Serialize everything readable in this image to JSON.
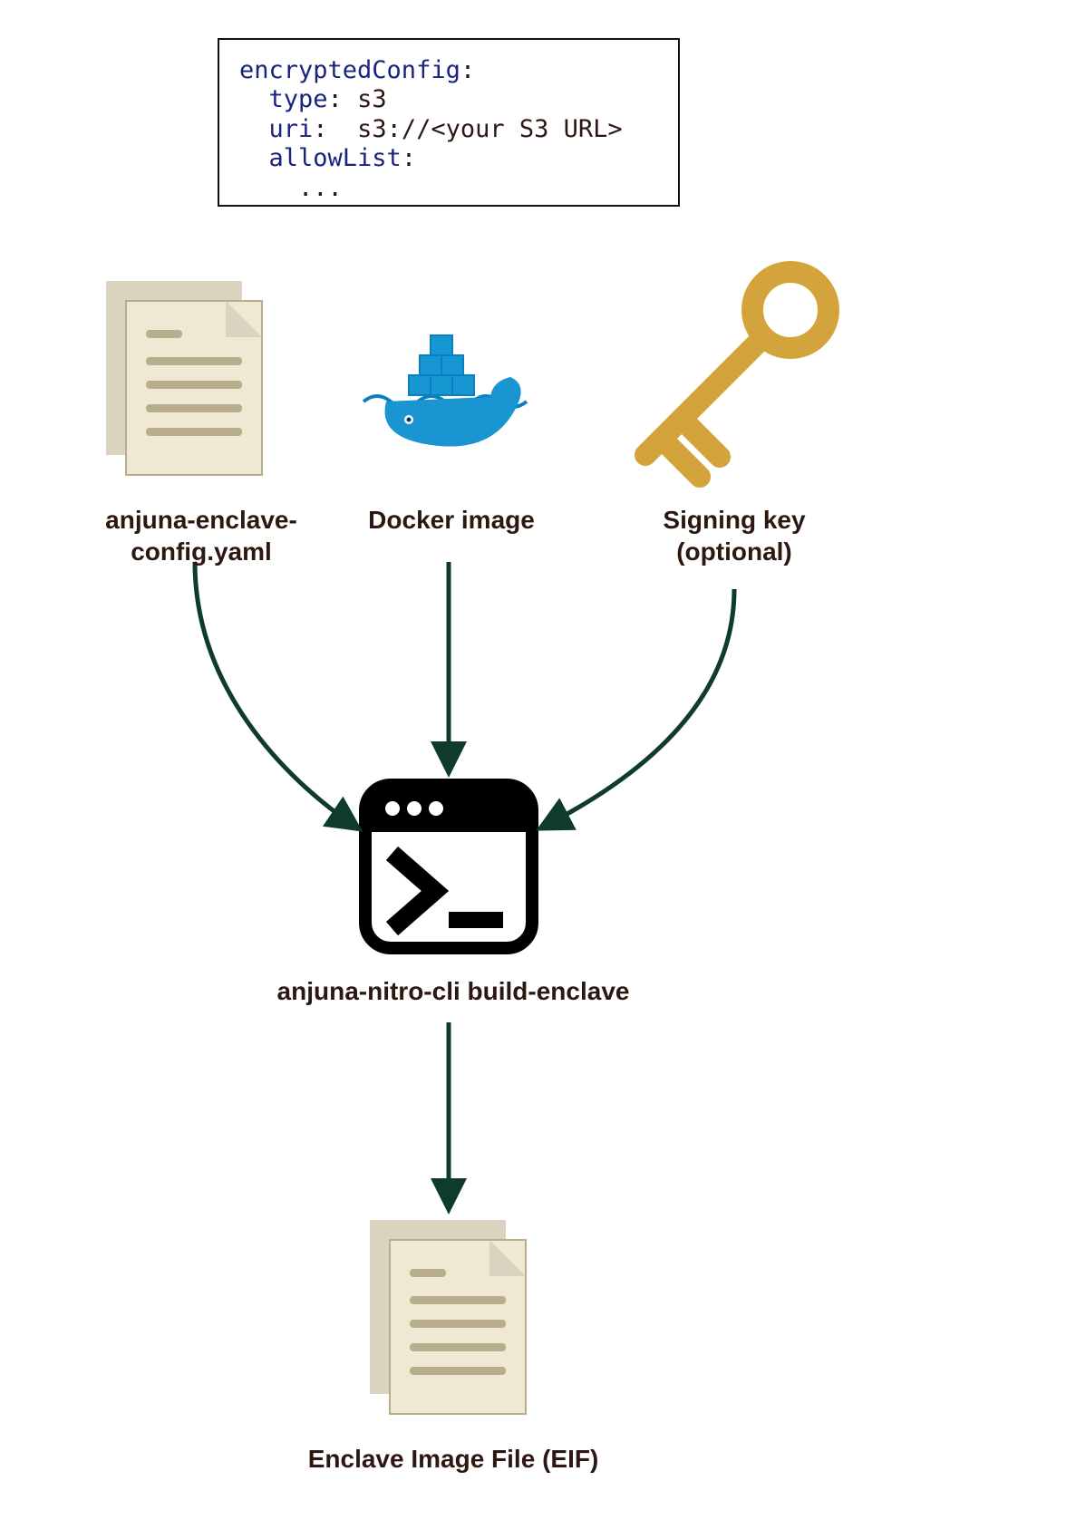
{
  "codebox": {
    "line1_key": "encryptedConfig",
    "line2_key": "type",
    "line2_val": "s3",
    "line3_key": "uri",
    "line3_val": "s3://<your S3 URL>",
    "line4_key": "allowList",
    "line5": "..."
  },
  "nodes": {
    "config_label": "anjuna-enclave-config.yaml",
    "docker_label": "Docker image",
    "key_label_line1": "Signing key",
    "key_label_line2": "(optional)",
    "cli_label": "anjuna-nitro-cli build-enclave",
    "eif_label": "Enclave Image File (EIF)"
  }
}
